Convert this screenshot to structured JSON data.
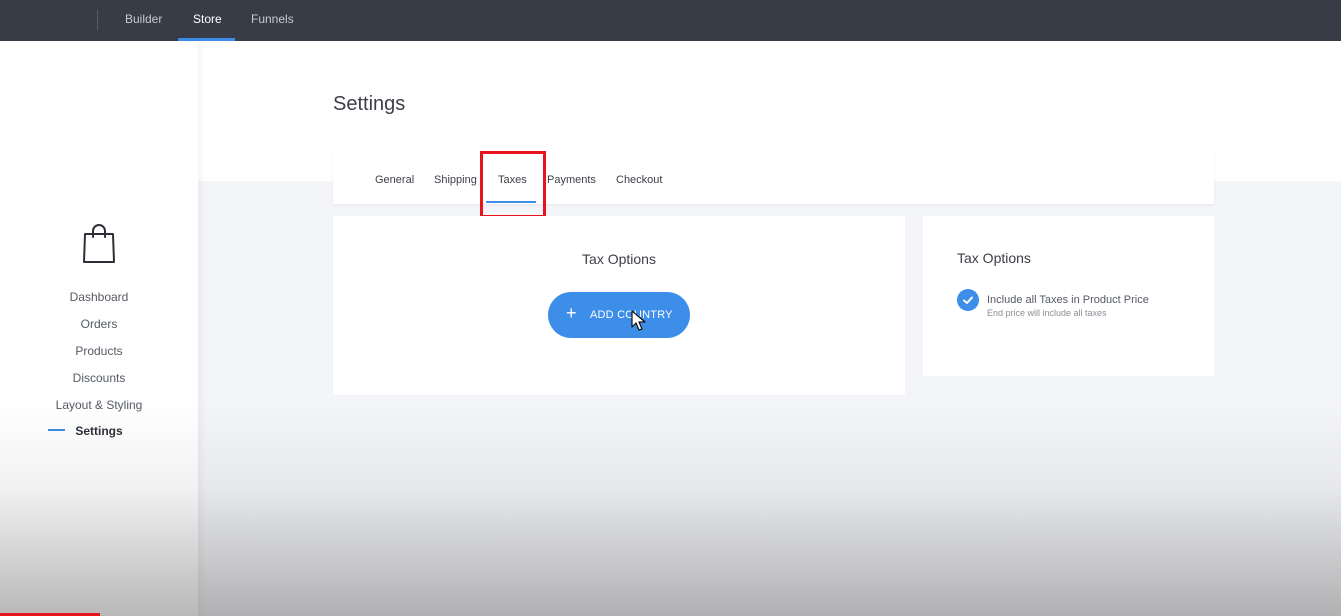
{
  "topnav": {
    "items": [
      {
        "label": "Builder",
        "active": false
      },
      {
        "label": "Store",
        "active": true
      },
      {
        "label": "Funnels",
        "active": false
      }
    ]
  },
  "sidebar": {
    "icon": "shopping-bag-icon",
    "items": [
      {
        "label": "Dashboard",
        "active": false
      },
      {
        "label": "Orders",
        "active": false
      },
      {
        "label": "Products",
        "active": false
      },
      {
        "label": "Discounts",
        "active": false
      },
      {
        "label": "Layout & Styling",
        "active": false
      },
      {
        "label": "Settings",
        "active": true
      }
    ]
  },
  "page": {
    "title": "Settings"
  },
  "tabs": {
    "items": [
      {
        "label": "General"
      },
      {
        "label": "Shipping"
      },
      {
        "label": "Taxes"
      },
      {
        "label": "Payments"
      },
      {
        "label": "Checkout"
      }
    ],
    "active": "Taxes"
  },
  "tax_main": {
    "title": "Tax Options",
    "add_button_label": "ADD COUNTRY"
  },
  "tax_side": {
    "title": "Tax Options",
    "checkbox_label": "Include all Taxes in Product Price",
    "checkbox_sublabel": "End price will include all taxes",
    "checked": true
  },
  "colors": {
    "accent": "#3d8ee8",
    "topbar": "#383c47",
    "highlight": "#e8141c"
  }
}
